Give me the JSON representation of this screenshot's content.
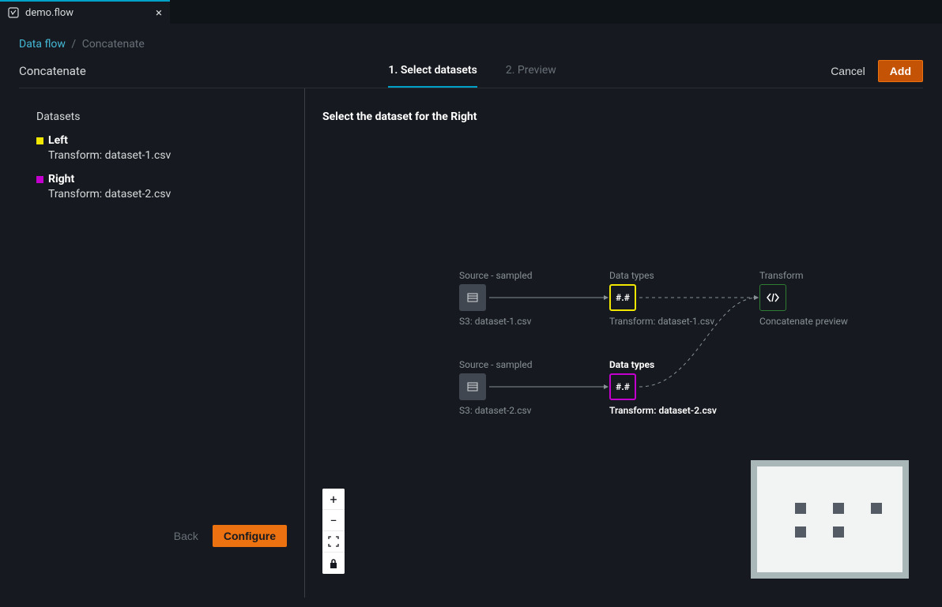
{
  "tab": {
    "title": "demo.flow"
  },
  "breadcrumb": {
    "root": "Data flow",
    "current": "Concatenate"
  },
  "page": {
    "title": "Concatenate"
  },
  "steps": [
    {
      "label": "1. Select datasets",
      "active": true
    },
    {
      "label": "2. Preview",
      "active": false
    }
  ],
  "actions": {
    "cancel": "Cancel",
    "add": "Add"
  },
  "sidebar": {
    "heading": "Datasets",
    "items": [
      {
        "name": "Left",
        "sub": "Transform: dataset-1.csv",
        "color": "#f2e701"
      },
      {
        "name": "Right",
        "sub": "Transform: dataset-2.csv",
        "color": "#c400cf"
      }
    ],
    "back": "Back",
    "configure": "Configure"
  },
  "canvas": {
    "heading": "Select the dataset for the Right",
    "columns": {
      "source": "Source - sampled",
      "datatypes": "Data types",
      "transform": "Transform"
    },
    "nodes": {
      "src1_sub": "S3: dataset-1.csv",
      "src2_sub": "S3: dataset-2.csv",
      "dt_glyph": "#.#",
      "dt1_sub": "Transform: dataset-1.csv",
      "dt2_sub": "Transform: dataset-2.csv",
      "tf_sub": "Concatenate preview"
    }
  }
}
